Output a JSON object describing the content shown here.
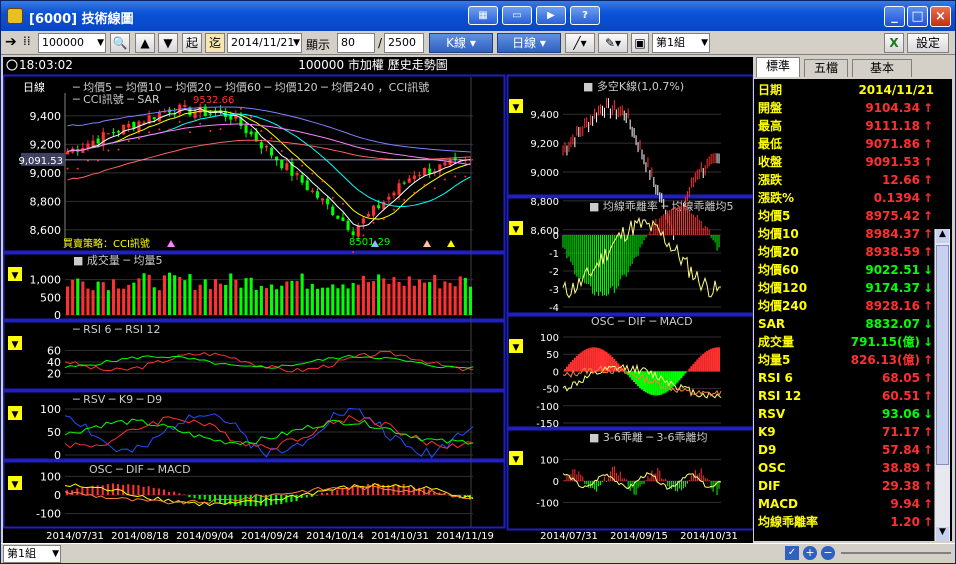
{
  "window": {
    "title": "[6000] 技術線圖"
  },
  "toolbar": {
    "symbol": "100000",
    "date": "2014/11/21",
    "display_label": "顯示",
    "count": "80",
    "total": "/",
    "total_count": "2500",
    "kline": "K線",
    "period": "日線",
    "group": "第1組",
    "settings": "設定",
    "start": "起",
    "calc": "迄"
  },
  "header": {
    "time": "18:03:02",
    "title": "100000 市加權  歷史走勢圖"
  },
  "main_panel": {
    "legend": "日線  ─ 均價5  ─ 均價10  ─ 均價20  ─ 均價60  ─ 均價120  ─ 均價240 ，CCI訊號",
    "legend2": "─ CCI訊號  ─ SAR",
    "high_label": "9532.66",
    "low_label": "8501.29",
    "current_price": "9,091.53",
    "strategy": "買賣策略：CCI訊號",
    "yticks": [
      "9,400",
      "9,200",
      "9,000",
      "8,800",
      "8,600"
    ]
  },
  "vol_panel": {
    "legend": "■ 成交量  ─ 均量5",
    "yticks": [
      "1,000",
      "500",
      "0"
    ]
  },
  "rsi_panel": {
    "legend": "─ RSI 6  ─ RSI 12",
    "yticks": [
      "60",
      "40",
      "20"
    ]
  },
  "kd_panel": {
    "legend": "─ RSV  ─ K9  ─ D9",
    "yticks": [
      "100",
      "50",
      "0"
    ]
  },
  "macd_panel": {
    "legend": "OSC  ─ DIF  ─ MACD",
    "yticks": [
      "100",
      "0",
      "-100"
    ]
  },
  "xaxis": [
    "2014/07/31",
    "2014/08/18",
    "2014/09/04",
    "2014/09/24",
    "2014/10/14",
    "2014/10/31",
    "2014/11/19"
  ],
  "right_xaxis": [
    "2014/07/31",
    "2014/09/15",
    "2014/10/31"
  ],
  "r1": {
    "legend": "■ 多空K線(1,0.7%)",
    "yticks": [
      "9,400",
      "9,200",
      "9,000",
      "8,800",
      "8,600"
    ]
  },
  "r2": {
    "legend": "■ 均線乖離率  ─ 均線乖離均5",
    "yticks": [
      "0",
      "-1",
      "-2",
      "-3",
      "-4"
    ]
  },
  "r3": {
    "legend": "OSC  ─ DIF  ─ MACD",
    "yticks": [
      "100",
      "50",
      "0",
      "-50",
      "-100",
      "-150"
    ]
  },
  "r4": {
    "legend": "■ 3-6乖離  ─ 3-6乖離均",
    "yticks": [
      "100",
      "0",
      "-100"
    ]
  },
  "side_tabs": [
    "標準",
    "五檔",
    "基本"
  ],
  "quote": [
    {
      "label": "日期",
      "value": "2014/11/21",
      "color": "#ffff00",
      "arrow": ""
    },
    {
      "label": "開盤",
      "value": "9104.34",
      "color": "#ff3030",
      "arrow": "↑"
    },
    {
      "label": "最高",
      "value": "9111.18",
      "color": "#ff3030",
      "arrow": "↑"
    },
    {
      "label": "最低",
      "value": "9071.86",
      "color": "#ff3030",
      "arrow": "↑"
    },
    {
      "label": "收盤",
      "value": "9091.53",
      "color": "#ff3030",
      "arrow": "↑"
    },
    {
      "label": "漲跌",
      "value": "12.66",
      "color": "#ff3030",
      "arrow": "↑"
    },
    {
      "label": "漲跌%",
      "value": "0.1394",
      "color": "#ff3030",
      "arrow": "↑"
    },
    {
      "label": "均價5",
      "value": "8975.42",
      "color": "#ff3030",
      "arrow": "↑"
    },
    {
      "label": "均價10",
      "value": "8984.37",
      "color": "#ff3030",
      "arrow": "↑"
    },
    {
      "label": "均價20",
      "value": "8938.59",
      "color": "#ff3030",
      "arrow": "↑"
    },
    {
      "label": "均價60",
      "value": "9022.51",
      "color": "#00ff00",
      "arrow": "↓"
    },
    {
      "label": "均價120",
      "value": "9174.37",
      "color": "#00ff00",
      "arrow": "↓"
    },
    {
      "label": "均價240",
      "value": "8928.16",
      "color": "#ff3030",
      "arrow": "↑"
    },
    {
      "label": "SAR",
      "value": "8832.07",
      "color": "#00ff00",
      "arrow": "↓"
    },
    {
      "label": "成交量",
      "value": "791.15(億)",
      "color": "#00ff00",
      "arrow": "↓"
    },
    {
      "label": "均量5",
      "value": "826.13(億)",
      "color": "#ff3030",
      "arrow": "↑"
    },
    {
      "label": "RSI 6",
      "value": "68.05",
      "color": "#ff3030",
      "arrow": "↑"
    },
    {
      "label": "RSI 12",
      "value": "60.51",
      "color": "#ff3030",
      "arrow": "↑"
    },
    {
      "label": "RSV",
      "value": "93.06",
      "color": "#00ff00",
      "arrow": "↓"
    },
    {
      "label": "K9",
      "value": "71.17",
      "color": "#ff3030",
      "arrow": "↑"
    },
    {
      "label": "D9",
      "value": "57.84",
      "color": "#ff3030",
      "arrow": "↑"
    },
    {
      "label": "OSC",
      "value": "38.89",
      "color": "#ff3030",
      "arrow": "↑"
    },
    {
      "label": "DIF",
      "value": "29.38",
      "color": "#ff3030",
      "arrow": "↑"
    },
    {
      "label": "MACD",
      "value": "9.94",
      "color": "#ff3030",
      "arrow": "↑"
    },
    {
      "label": "均線乖離率",
      "value": "1.20",
      "color": "#ff3030",
      "arrow": "↑"
    }
  ],
  "status": {
    "group": "第1組"
  }
}
